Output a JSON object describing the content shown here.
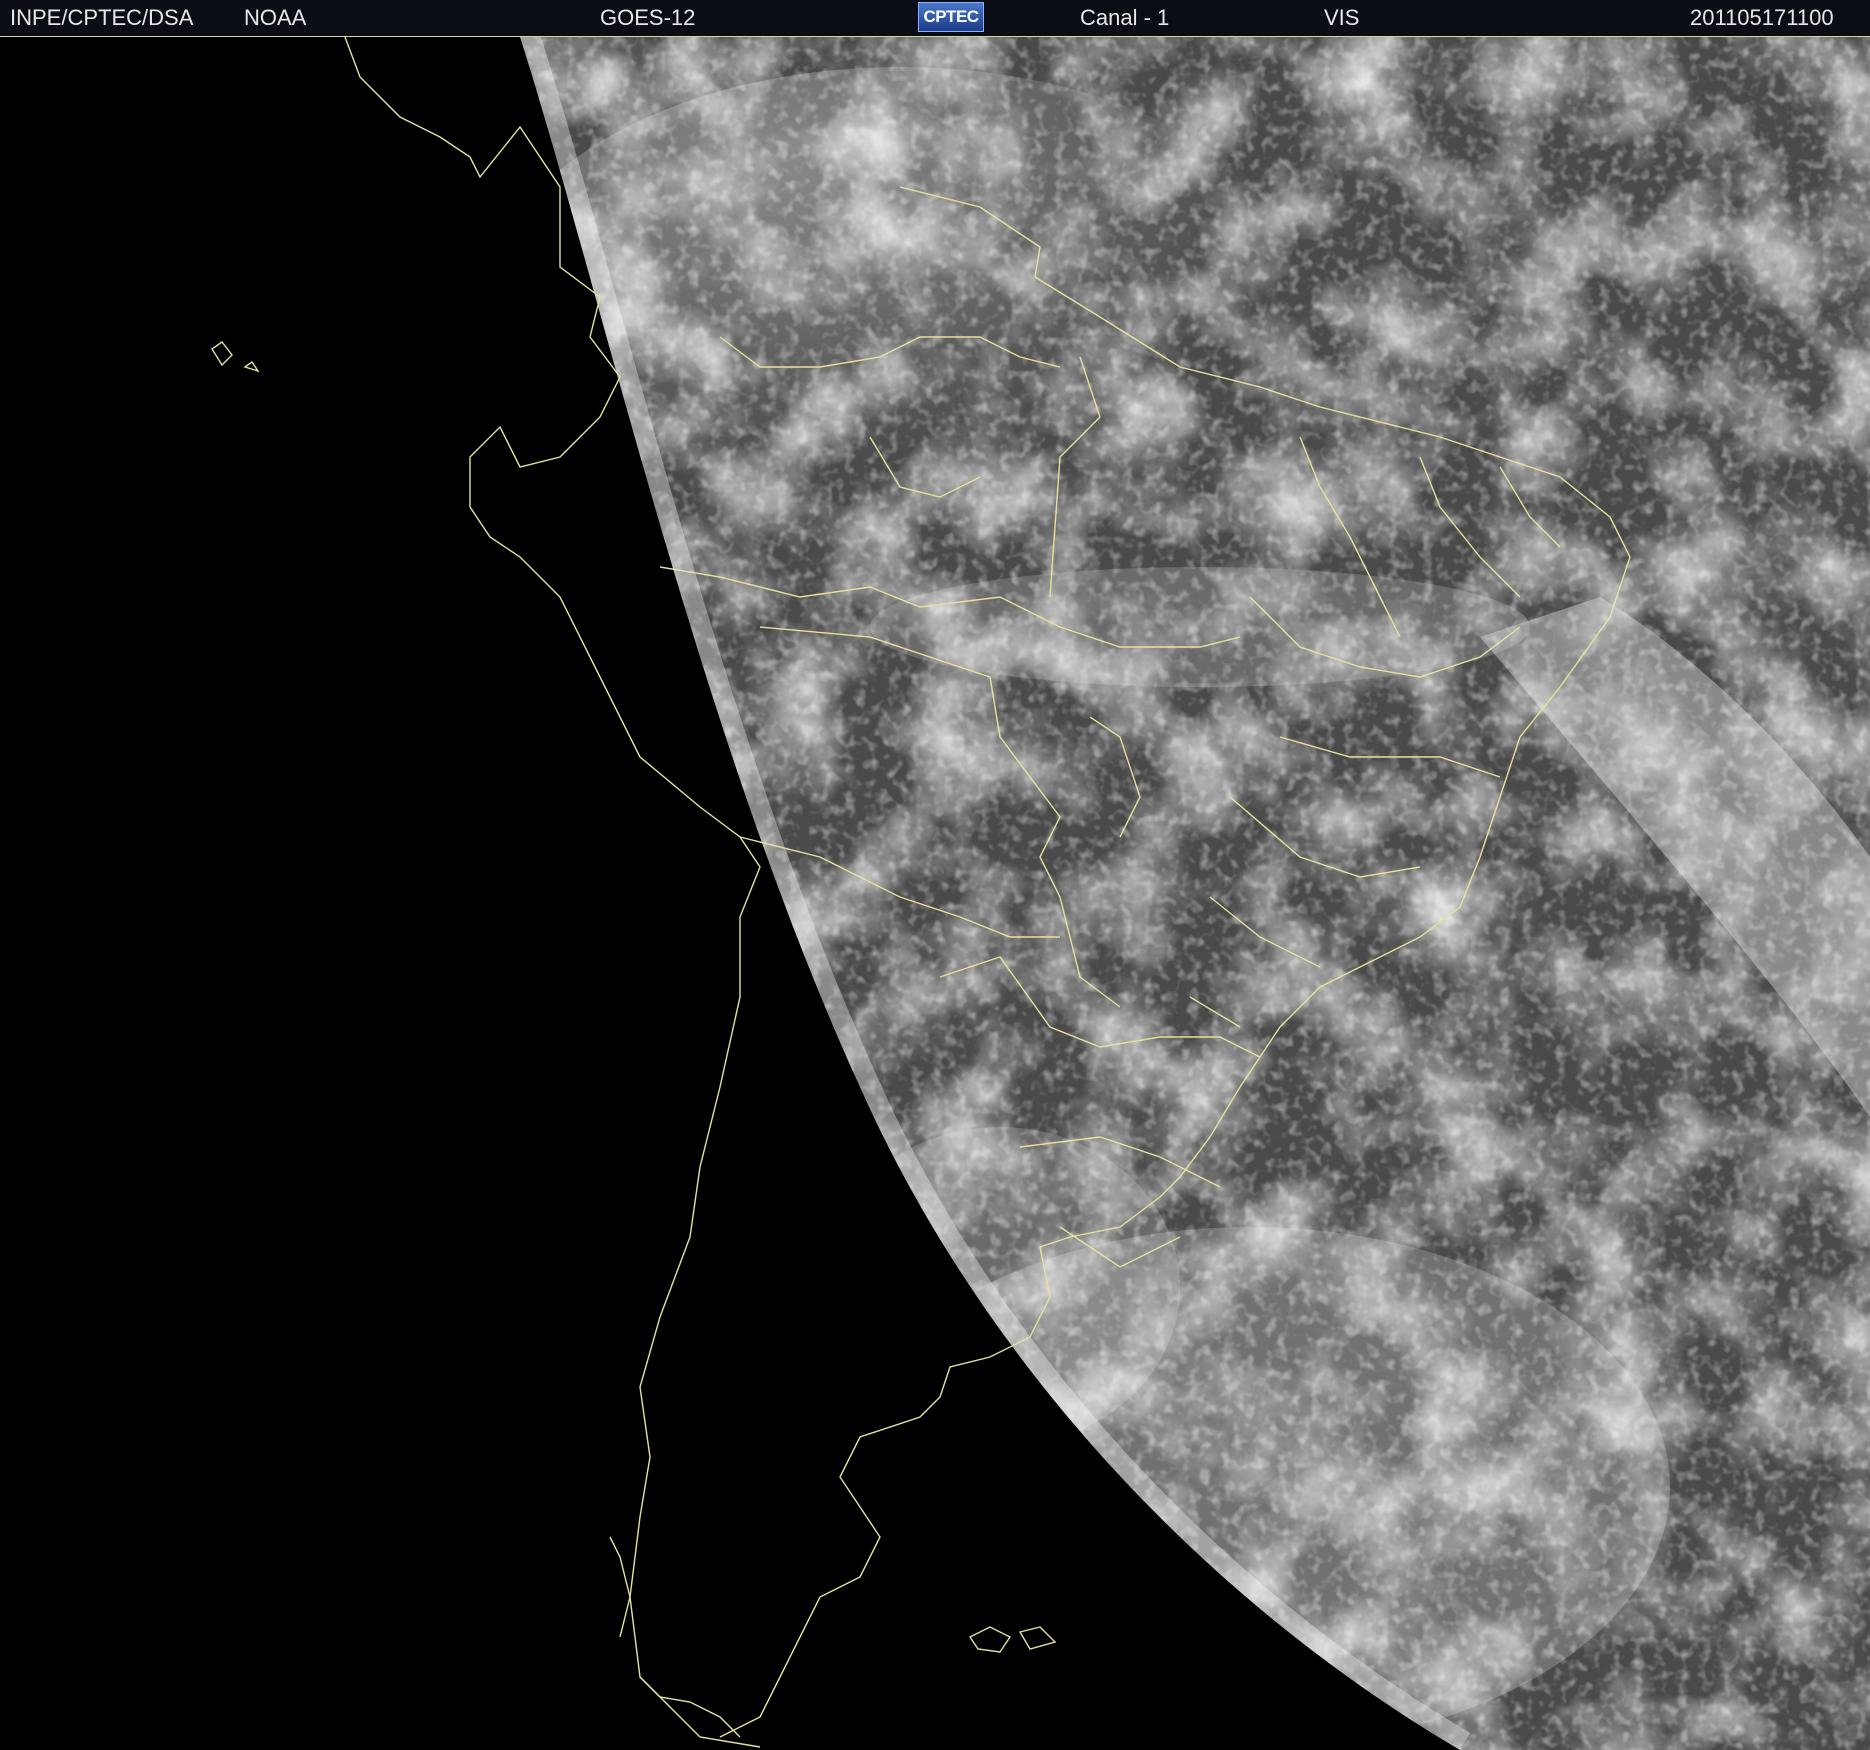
{
  "header": {
    "institution": "INPE/CPTEC/DSA",
    "agency": "NOAA",
    "satellite": "GOES-12",
    "logo_text": "CPTEC",
    "channel": "Canal - 1",
    "band": "VIS",
    "timestamp": "201105171100"
  },
  "image": {
    "subject": "visible satellite image of South America",
    "coastline_color": "#e6e29c",
    "night_side_color": "#000000",
    "header_background": "#0a0d16"
  }
}
